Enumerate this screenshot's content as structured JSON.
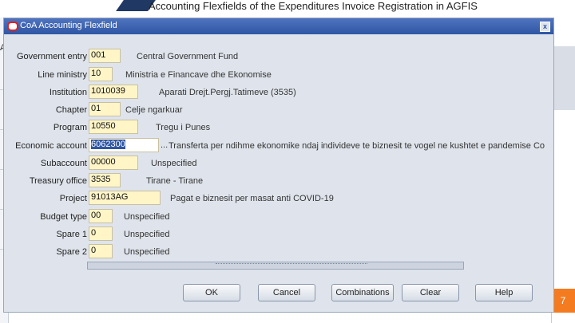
{
  "slide": {
    "title": "Accounting Flexfields of the Expenditures Invoice Registration in AGFIS",
    "page_number": "7",
    "bg_letter": "A"
  },
  "dialog": {
    "title": "CoA Accounting Flexfield",
    "close_symbol": "x"
  },
  "fields": [
    {
      "label": "Government entry",
      "value": "001",
      "description": "Central Government Fund"
    },
    {
      "label": "Line ministry",
      "value": "10",
      "description": "Ministria e Financave dhe Ekonomise"
    },
    {
      "label": "Institution",
      "value": "1010039",
      "description": "Aparati Drejt.Pergj.Tatimeve (3535)"
    },
    {
      "label": "Chapter",
      "value": "01",
      "description": "Celje ngarkuar"
    },
    {
      "label": "Program",
      "value": "10550",
      "description": "Tregu i Punes"
    },
    {
      "label": "Economic account",
      "value": "6062300",
      "lov_symbol": "...",
      "description": "Transferta per ndihme ekonomike ndaj individeve te biznesit te vogel ne kushtet e pandemise Co"
    },
    {
      "label": "Subaccount",
      "value": "00000",
      "description": "Unspecified"
    },
    {
      "label": "Treasury office",
      "value": "3535",
      "description": "Tirane - Tirane"
    },
    {
      "label": "Project",
      "value": "91013AG",
      "description": "Pagat e biznesit per masat anti COVID-19"
    },
    {
      "label": "Budget type",
      "value": "00",
      "description": "Unspecified"
    },
    {
      "label": "Spare 1",
      "value": "0",
      "description": "Unspecified"
    },
    {
      "label": "Spare 2",
      "value": "0",
      "description": "Unspecified"
    }
  ],
  "buttons": {
    "ok": "OK",
    "cancel": "Cancel",
    "combinations": "Combinations",
    "clear": "Clear",
    "help": "Help"
  }
}
